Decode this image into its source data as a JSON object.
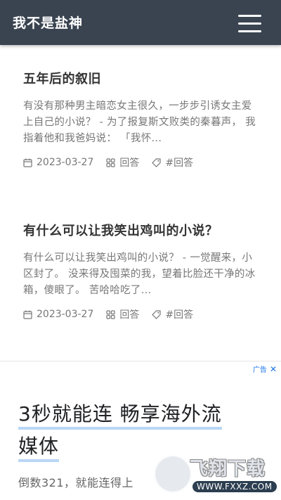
{
  "header": {
    "title": "我不是盐神",
    "menu_icon": "hamburger-icon"
  },
  "posts": [
    {
      "title": "五年后的叙旧",
      "excerpt": "有没有那种男主暗恋女主很久，一步步引诱女主爱上自己的小说？ - 为了报复斯文败类的秦暮声， 我指着他和我爸妈说： 「我怀...",
      "date": "2023-03-27",
      "category": "回答",
      "tag": "#回答"
    },
    {
      "title": "有什么可以让我笑出鸡叫的小说？",
      "excerpt": "有什么可以让我笑出鸡叫的小说？ - 一觉醒来，小区封了。 没来得及囤菜的我，望着比脸还干净的冰箱，傻眼了。 苦哈哈吃了...",
      "date": "2023-03-27",
      "category": "回答",
      "tag": "#回答"
    }
  ],
  "ad": {
    "label": "广告",
    "close": "✕",
    "headline_line1": "3秒就能连 畅享海外流",
    "headline_line2": "媒体",
    "sub": "倒数321，就能连得上"
  },
  "watermark": {
    "text": "飞翔下载",
    "url": "WWW.FXXZ.COM"
  }
}
